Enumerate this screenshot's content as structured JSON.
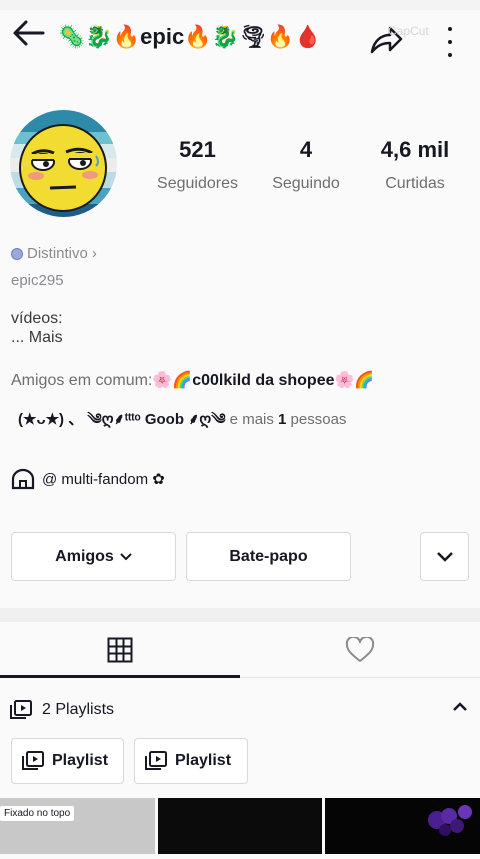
{
  "header": {
    "title": "🦠🐉🔥epic🔥🐉🌪🔥🩸",
    "watermark": "CapCut"
  },
  "profile": {
    "stats": [
      {
        "value": "521",
        "label": "Seguidores"
      },
      {
        "value": "4",
        "label": "Seguindo"
      },
      {
        "value": "4,6 mil",
        "label": "Curtidas"
      }
    ],
    "badge_label": "Distintivo",
    "badge_chevron": "›",
    "username": "epic295",
    "bio_line1": "vídeos:",
    "bio_line2": "...  Mais",
    "friends_prefix": "Amigos em comum:",
    "friends_name1": "🌸🌈c00lkild da shopee🌸🌈",
    "friends_name2": "(★ᴗ★) 、 ༄ღ⸙ᵗᵗᵗᵒ Goob ⸙ღ༄",
    "friends_suffix1": " e mais ",
    "friends_count": "1",
    "friends_suffix2": " pessoas",
    "link_text": "@ multi-fandom ✿"
  },
  "actions": {
    "friends_button": "Amigos",
    "chat_button": "Bate-papo"
  },
  "playlists": {
    "header": "2 Playlists",
    "items": [
      {
        "label": "Playlist"
      },
      {
        "label": "Playlist"
      }
    ]
  },
  "grid": {
    "pinned_label": "Fixado no topo"
  },
  "colors": {
    "text_primary": "#161823",
    "text_secondary": "#6e6e6e",
    "border": "#d9d9dc"
  }
}
